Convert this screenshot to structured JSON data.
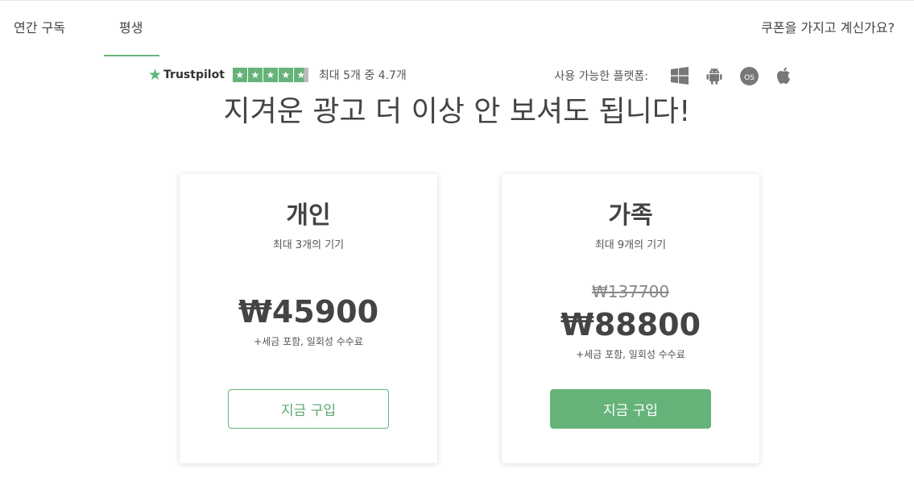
{
  "tabs": [
    {
      "label": "연간 구독",
      "selected": false
    },
    {
      "label": "평생",
      "selected": true
    }
  ],
  "coupon_link": "쿠폰을 가지고 계신가요?",
  "trustpilot": {
    "name": "Trustpilot",
    "stars": 5,
    "rating_text": "최대 5개 중 4.7개"
  },
  "platforms": {
    "label": "사용 가능한 플랫폼:",
    "icons": [
      "windows-icon",
      "android-icon",
      "macos-icon",
      "apple-icon"
    ]
  },
  "headline": "지겨운 광고 더 이상 안 보셔도 됩니다!",
  "plans": [
    {
      "name": "개인",
      "devices": "최대 3개의 기기",
      "price": "₩45900",
      "tax_note": "+세금 포함, 일회성 수수료",
      "buy_label": "지금 구입"
    },
    {
      "name": "가족",
      "devices": "최대 9개의 기기",
      "old_price": "₩137700",
      "price": "₩88800",
      "tax_note": "+세금 포함, 일회성 수수료",
      "buy_label": "지금 구입"
    }
  ],
  "colors": {
    "accent": "#66b37a",
    "text": "#444444",
    "icon": "#777777"
  }
}
